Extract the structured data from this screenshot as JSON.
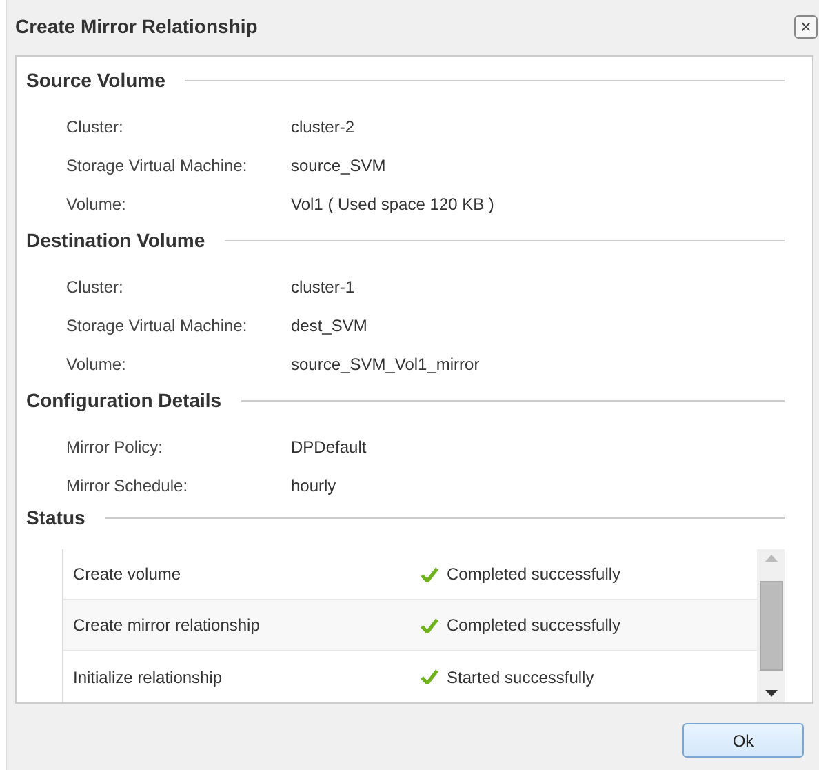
{
  "window": {
    "title": "Create Mirror Relationship",
    "close": "×"
  },
  "sections": [
    {
      "title": "Source Volume",
      "fields": [
        {
          "label": "Cluster:",
          "value": "cluster-2"
        },
        {
          "label": "Storage Virtual Machine:",
          "value": "source_SVM"
        },
        {
          "label": "Volume:",
          "value": "Vol1 ( Used space 120 KB )"
        }
      ]
    },
    {
      "title": "Destination Volume",
      "fields": [
        {
          "label": "Cluster:",
          "value": "cluster-1"
        },
        {
          "label": "Storage Virtual Machine:",
          "value": "dest_SVM"
        },
        {
          "label": "Volume:",
          "value": "source_SVM_Vol1_mirror"
        }
      ]
    },
    {
      "title": "Configuration Details",
      "fields": [
        {
          "label": "Mirror Policy:",
          "value": "DPDefault"
        },
        {
          "label": "Mirror Schedule:",
          "value": "hourly"
        }
      ]
    }
  ],
  "status": {
    "title": "Status",
    "rows": [
      {
        "task": "Create volume",
        "result": "Completed successfully"
      },
      {
        "task": "Create mirror relationship",
        "result": "Completed successfully"
      },
      {
        "task": "Initialize relationship",
        "result": "Started successfully"
      }
    ]
  },
  "buttons": [
    "Ok"
  ]
}
